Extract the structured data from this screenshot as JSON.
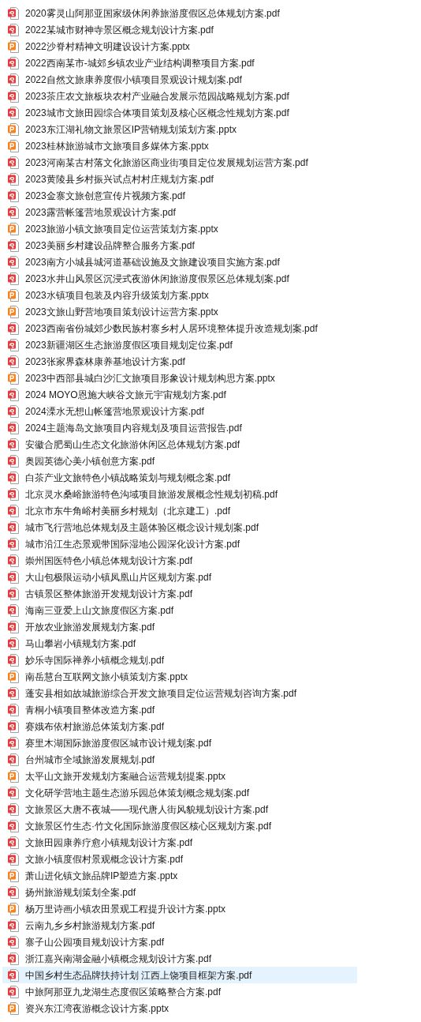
{
  "files": [
    {
      "name": "2020雾灵山阿那亚国家级休闲养旅游度假区总体规划方案.pdf",
      "kind": "pdf",
      "selected": false
    },
    {
      "name": "2022某城市财神寺景区概念规划设计方案.pdf",
      "kind": "pdf",
      "selected": false
    },
    {
      "name": "2022沙脊村精神文明建设设计方案.pptx",
      "kind": "pptx",
      "selected": false
    },
    {
      "name": "2022西南某市-城郊乡镇农业产业结构调整项目方案.pdf",
      "kind": "pdf",
      "selected": false
    },
    {
      "name": "2022自然文旅康养度假小镇项目景观设计规划案.pdf",
      "kind": "pdf",
      "selected": false
    },
    {
      "name": "2023茶庄农文旅板块农村产业融合发展示范园战略规划方案.pdf",
      "kind": "pdf",
      "selected": false
    },
    {
      "name": "2023城市文旅田园综合体项目策划及核心区概念性规划方案.pdf",
      "kind": "pdf",
      "selected": false
    },
    {
      "name": "2023东江湖礼物文旅景区IP营销规划策划方案.pptx",
      "kind": "pptx",
      "selected": false
    },
    {
      "name": "2023桂林旅游城市文旅项目多媒体方案.pptx",
      "kind": "pptx",
      "selected": false
    },
    {
      "name": "2023河南某古村落文化旅游区商业街项目定位发展规划运营方案.pdf",
      "kind": "pdf",
      "selected": false
    },
    {
      "name": "2023黄陵县乡村振兴试点村村庄规划方案.pdf",
      "kind": "pdf",
      "selected": false
    },
    {
      "name": "2023金寨文旅创意宣传片视频方案.pdf",
      "kind": "pdf",
      "selected": false
    },
    {
      "name": "2023露营帐篷营地景观设计方案.pdf",
      "kind": "pdf",
      "selected": false
    },
    {
      "name": "2023旅游小镇文旅项目定位运营策划方案.pptx",
      "kind": "pptx",
      "selected": false
    },
    {
      "name": "2023美丽乡村建设品牌整合服务方案.pdf",
      "kind": "pdf",
      "selected": false
    },
    {
      "name": "2023南方小城县城河道基础设施及文旅建设项目实施方案.pdf",
      "kind": "pdf",
      "selected": false
    },
    {
      "name": "2023水井山风景区沉浸式夜游休闲旅游度假景区总体规划案.pdf",
      "kind": "pdf",
      "selected": false
    },
    {
      "name": "2023水镇项目包装及内容升级策划方案.pptx",
      "kind": "pptx",
      "selected": false
    },
    {
      "name": "2023文旅山野营地项目策划设计运营方案.pptx",
      "kind": "pptx",
      "selected": false
    },
    {
      "name": "2023西南省份城郊少数民族村寨乡村人居环境整体提升改造规划案.pdf",
      "kind": "pdf",
      "selected": false
    },
    {
      "name": "2023新疆湖区生态旅游度假区项目规划定位案.pdf",
      "kind": "pdf",
      "selected": false
    },
    {
      "name": "2023张家界森林康养基地设计方案.pdf",
      "kind": "pdf",
      "selected": false
    },
    {
      "name": "2023中西部县城白沙汇文旅项目形象设计规划构思方案.pptx",
      "kind": "pptx",
      "selected": false
    },
    {
      "name": "2024 MOYO恩施大峡谷文旅元宇宙规划方案.pdf",
      "kind": "pdf",
      "selected": false
    },
    {
      "name": "2024溧水无想山帐篷营地景观设计方案.pdf",
      "kind": "pdf",
      "selected": false
    },
    {
      "name": "2024主题海岛文旅项目内容规划及项目运营报告.pdf",
      "kind": "pdf",
      "selected": false
    },
    {
      "name": "安徽合肥蜀山生态文化旅游休闲区总体规划方案.pdf",
      "kind": "pdf",
      "selected": false
    },
    {
      "name": "奥园英德心美小镇创意方案.pdf",
      "kind": "pdf",
      "selected": false
    },
    {
      "name": "白茶产业文旅特色小镇战略策划与规划概念案.pdf",
      "kind": "pdf",
      "selected": false
    },
    {
      "name": "北京灵水桑峪旅游特色沟域项目旅游发展概念性规划初稿.pdf",
      "kind": "pdf",
      "selected": false
    },
    {
      "name": "北京市东牛角峪村美丽乡村规划（北京建工）.pdf",
      "kind": "pdf",
      "selected": false
    },
    {
      "name": "城市飞行营地总体规划及主题体验区概念设计规划案.pdf",
      "kind": "pdf",
      "selected": false
    },
    {
      "name": "城市沿江生态景观带国际湿地公园深化设计方案.pdf",
      "kind": "pdf",
      "selected": false
    },
    {
      "name": "崇州国医特色小镇总体规划设计方案.pdf",
      "kind": "pdf",
      "selected": false
    },
    {
      "name": "大山包极限运动小镇凤凰山片区规划方案.pdf",
      "kind": "pdf",
      "selected": false
    },
    {
      "name": "古镇景区整体旅游开发规划设计方案.pdf",
      "kind": "pdf",
      "selected": false
    },
    {
      "name": "海南三亚爱上山文旅度假区方案.pdf",
      "kind": "pdf",
      "selected": false
    },
    {
      "name": "开放农业旅游发展规划方案.pdf",
      "kind": "pdf",
      "selected": false
    },
    {
      "name": "马山攀岩小镇规划方案.pdf",
      "kind": "pdf",
      "selected": false
    },
    {
      "name": "妙乐寺国际禅养小镇概念规划.pdf",
      "kind": "pdf",
      "selected": false
    },
    {
      "name": "南岳慧台互联网文旅小镇策划方案.pptx",
      "kind": "pptx",
      "selected": false
    },
    {
      "name": "蓬安县相如故城旅游综合开发文旅项目定位运营规划咨询方案.pdf",
      "kind": "pdf",
      "selected": false
    },
    {
      "name": "青桐小镇项目整体改造方案.pdf",
      "kind": "pdf",
      "selected": false
    },
    {
      "name": "赛娥布依村旅游总体策划方案.pdf",
      "kind": "pdf",
      "selected": false
    },
    {
      "name": "赛里木湖国际旅游度假区城市设计规划案.pdf",
      "kind": "pdf",
      "selected": false
    },
    {
      "name": "台州城市全域旅游发展规划.pdf",
      "kind": "pdf",
      "selected": false
    },
    {
      "name": "太平山文旅开发规划方案融合运营规划提案.pptx",
      "kind": "pptx",
      "selected": false
    },
    {
      "name": "文化研学营地主题生态游乐园总体策划概念规划案.pdf",
      "kind": "pdf",
      "selected": false
    },
    {
      "name": "文旅景区大唐不夜城——现代唐人街风貌规划设计方案.pdf",
      "kind": "pdf",
      "selected": false
    },
    {
      "name": "文旅景区竹生态·竹文化国际旅游度假区核心区规划方案.pdf",
      "kind": "pdf",
      "selected": false
    },
    {
      "name": "文旅田园康养疗愈小镇规划设计方案.pdf",
      "kind": "pdf",
      "selected": false
    },
    {
      "name": "文旅小镇度假村景观概念设计方案.pdf",
      "kind": "pdf",
      "selected": false
    },
    {
      "name": "萧山进化镇文旅品牌IP塑造方案.pptx",
      "kind": "pptx",
      "selected": false
    },
    {
      "name": "扬州旅游规划策划全案.pdf",
      "kind": "pdf",
      "selected": false
    },
    {
      "name": "杨万里诗画小镇农田景观工程提升设计方案.pptx",
      "kind": "pptx",
      "selected": false
    },
    {
      "name": "云南九乡乡村旅游规划方案.pdf",
      "kind": "pdf",
      "selected": false
    },
    {
      "name": "寨子山公园项目规划设计方案.pdf",
      "kind": "pdf",
      "selected": false
    },
    {
      "name": "浙江嘉兴南湖金融小镇概念规划设计方案.pdf",
      "kind": "pdf",
      "selected": false
    },
    {
      "name": "中国乡村生态品牌扶持计划 江西上饶项目框架方案.pdf",
      "kind": "pdf",
      "selected": true
    },
    {
      "name": "中旅阿那亚九龙湖生态度假区策略整合方案.pdf",
      "kind": "pdf",
      "selected": false
    },
    {
      "name": "资兴东江湾夜游概念设计方案.pptx",
      "kind": "pptx",
      "selected": false
    }
  ]
}
